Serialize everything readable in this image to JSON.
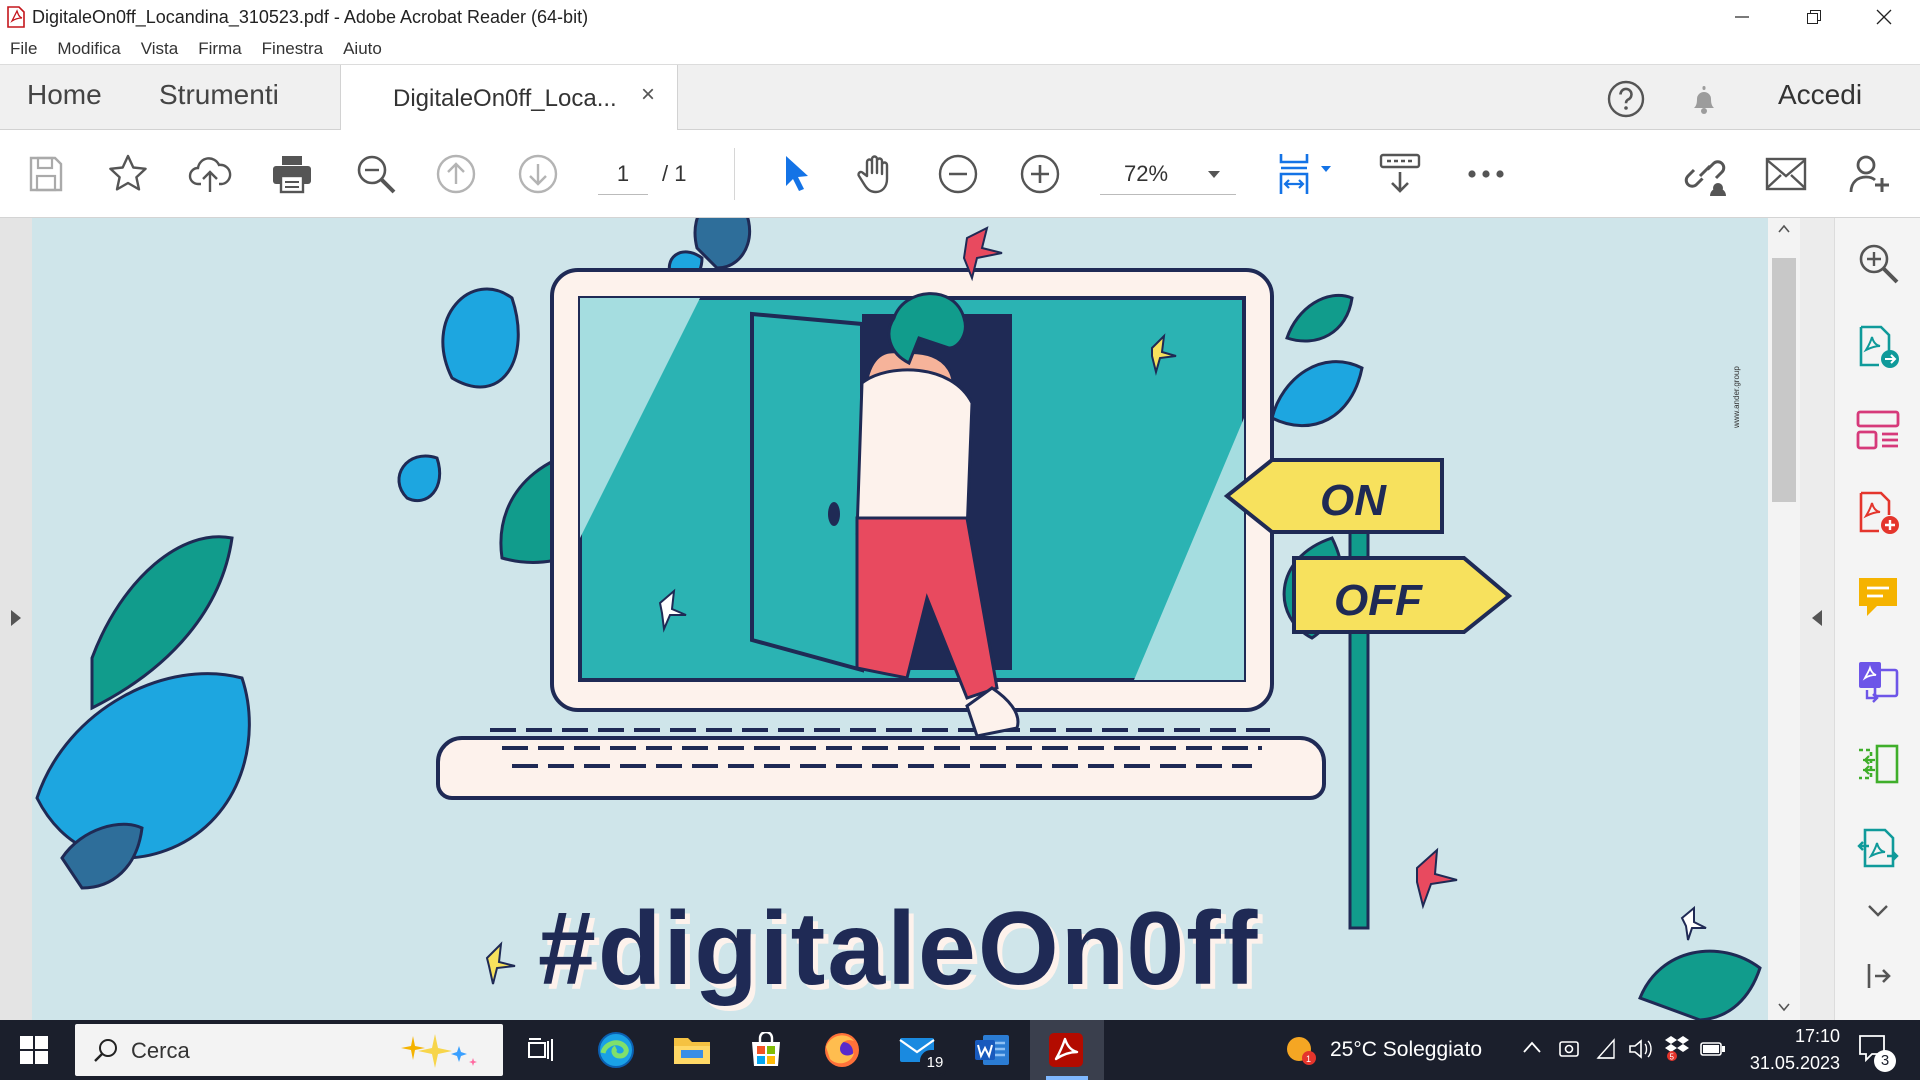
{
  "window": {
    "title": "DigitaleOn0ff_Locandina_310523.pdf - Adobe Acrobat Reader (64-bit)"
  },
  "menu": [
    "File",
    "Modifica",
    "Vista",
    "Firma",
    "Finestra",
    "Aiuto"
  ],
  "tabs": {
    "home": "Home",
    "tools": "Strumenti",
    "document": "DigitaleOn0ff_Loca...",
    "close": "×"
  },
  "header_right": {
    "signin": "Accedi"
  },
  "toolbar": {
    "page_current": "1",
    "page_total": "/ 1",
    "zoom": "72%"
  },
  "document": {
    "sign_on": "ON",
    "sign_off": "OFF",
    "hashtag": "#digitaleOn0ff",
    "side_credit": "www.ander.group"
  },
  "taskbar": {
    "search_placeholder": "Cerca",
    "mail_badge": "19",
    "weather": "25°C  Soleggiato",
    "time": "17:10",
    "date": "31.05.2023",
    "notif_count": "3"
  },
  "colors": {
    "accent_blue": "#1473e6",
    "acrobat_red": "#b30b00",
    "poster_bg": "#cfe5ea",
    "teal": "#2bb3b3",
    "navy": "#1f2a55",
    "yellow": "#f7e15d"
  }
}
